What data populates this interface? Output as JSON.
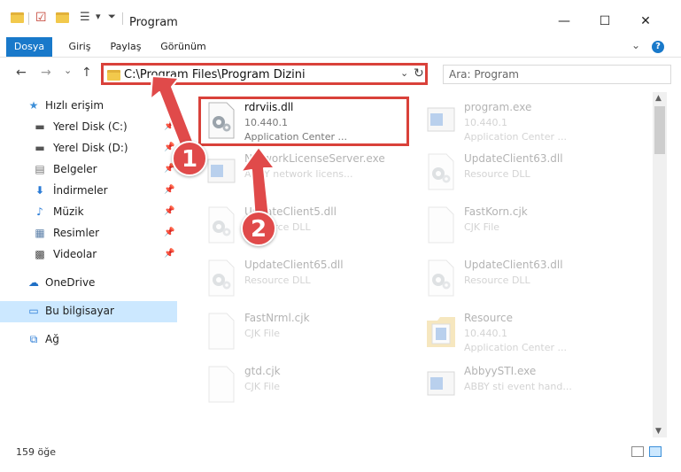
{
  "window": {
    "title": "Program",
    "minimize": "—",
    "maximize": "☐",
    "close": "✕"
  },
  "ribbon": {
    "tabs": [
      {
        "label": "Dosya",
        "active": true
      },
      {
        "label": "Giriş"
      },
      {
        "label": "Paylaş"
      },
      {
        "label": "Görünüm"
      }
    ],
    "help": "?"
  },
  "nav": {
    "back": "←",
    "forward": "→",
    "recent": "⌄",
    "up": "↑"
  },
  "address": {
    "path": "C:\\Program Files\\Program Dizini",
    "dropdown": "⌄",
    "refresh": "↻"
  },
  "search": {
    "placeholder": "Ara: Program"
  },
  "sidebar": {
    "items": [
      {
        "label": "Hızlı erişim",
        "icon": "star-icon"
      },
      {
        "label": "Yerel Disk (C:)",
        "icon": "drive-icon",
        "pinned": true
      },
      {
        "label": "Yerel Disk (D:)",
        "icon": "drive-icon",
        "pinned": true
      },
      {
        "label": "Belgeler",
        "icon": "document-icon",
        "pinned": true
      },
      {
        "label": "İndirmeler",
        "icon": "download-icon",
        "pinned": true
      },
      {
        "label": "Müzik",
        "icon": "music-icon",
        "pinned": true
      },
      {
        "label": "Resimler",
        "icon": "picture-icon",
        "pinned": true
      },
      {
        "label": "Videolar",
        "icon": "video-icon",
        "pinned": true
      },
      {
        "label": "OneDrive",
        "icon": "cloud-icon"
      },
      {
        "label": "Bu bilgisayar",
        "icon": "computer-icon",
        "selected": true
      },
      {
        "label": "Ağ",
        "icon": "network-icon"
      }
    ],
    "pin_glyph": "📌"
  },
  "files": [
    {
      "name": "rdrviis.dll",
      "line1": "10.440.1",
      "line2": "Application Center ...",
      "icon": "gear-file-icon",
      "highlight": true
    },
    {
      "name": "program.exe",
      "line1": "10.440.1",
      "line2": "Application Center ...",
      "icon": "exe-icon"
    },
    {
      "name": "NetworkLicenseServer.exe",
      "line1": "ABBY network licens...",
      "line2": "",
      "icon": "exe-icon"
    },
    {
      "name": "UpdateClient63.dll",
      "line1": "Resource DLL",
      "line2": "",
      "icon": "gear-file-icon"
    },
    {
      "name": "UpdateClient5.dll",
      "line1": "Resource DLL",
      "line2": "",
      "icon": "gear-file-icon"
    },
    {
      "name": "FastKorn.cjk",
      "line1": "CJK File",
      "line2": "",
      "icon": "blank-file-icon"
    },
    {
      "name": "UpdateClient65.dll",
      "line1": "Resource DLL",
      "line2": "",
      "icon": "gear-file-icon"
    },
    {
      "name": "UpdateClient63.dll",
      "line1": "Resource DLL",
      "line2": "",
      "icon": "gear-file-icon"
    },
    {
      "name": "FastNrml.cjk",
      "line1": "CJK File",
      "line2": "",
      "icon": "blank-file-icon"
    },
    {
      "name": "Resource",
      "line1": "10.440.1",
      "line2": "Application Center ...",
      "icon": "folder-icon"
    },
    {
      "name": "gtd.cjk",
      "line1": "CJK File",
      "line2": "",
      "icon": "blank-file-icon"
    },
    {
      "name": "AbbyySTI.exe",
      "line1": "ABBY sti event hand...",
      "line2": "",
      "icon": "exe-icon"
    }
  ],
  "status": {
    "count": "159 öğe"
  },
  "annotations": {
    "step1": "1",
    "step2": "2",
    "color": "#d9413a"
  }
}
